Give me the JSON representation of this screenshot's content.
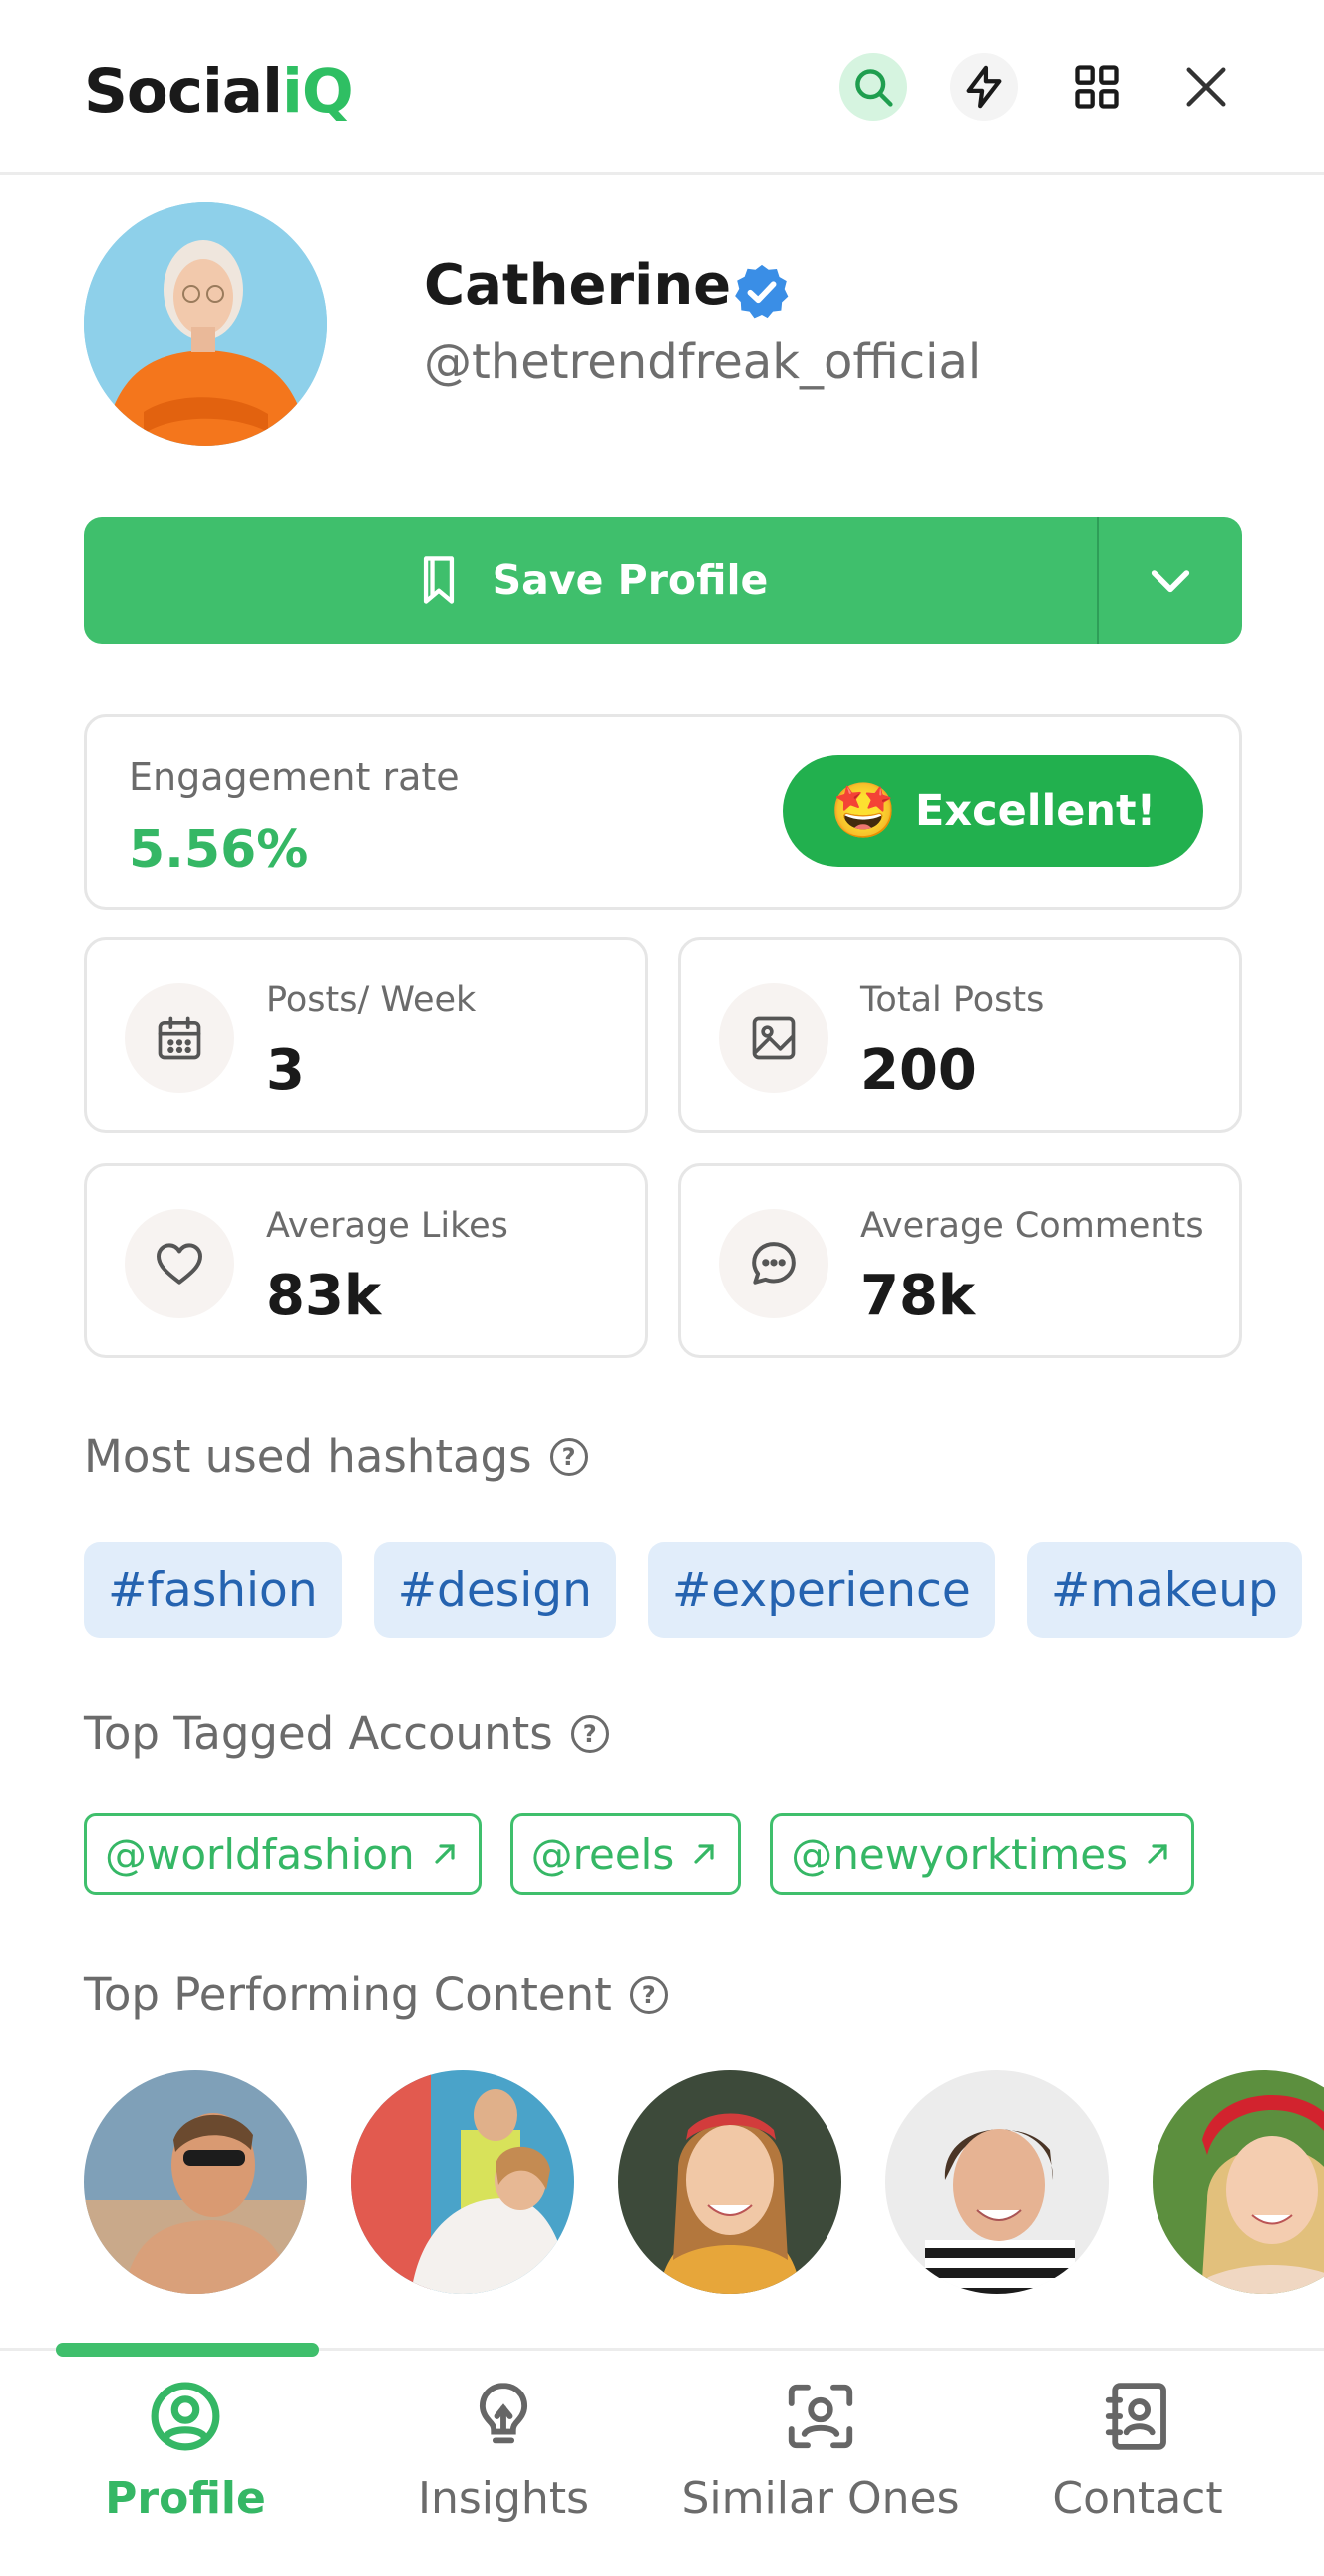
{
  "app": {
    "brand_main": "Social",
    "brand_accent": "iQ"
  },
  "header": {
    "icons": [
      "search-icon",
      "bolt-icon",
      "grid-icon",
      "close-icon"
    ]
  },
  "profile": {
    "name": "Catherine",
    "handle": "@thetrendfreak_official",
    "verified": true
  },
  "save": {
    "label": "Save Profile"
  },
  "engagement": {
    "label": "Engagement rate",
    "value": "5.56%",
    "badge": "Excellent!",
    "badge_emoji": "🤩"
  },
  "stats": [
    {
      "label": "Posts/ Week",
      "value": "3",
      "icon": "calendar-icon"
    },
    {
      "label": "Total Posts",
      "value": "200",
      "icon": "image-icon"
    },
    {
      "label": "Average Likes",
      "value": "83k",
      "icon": "heart-icon"
    },
    {
      "label": "Average Comments",
      "value": "78k",
      "icon": "chat-icon"
    }
  ],
  "hashtags": {
    "title": "Most used hashtags",
    "items": [
      "#fashion",
      "#design",
      "#experience",
      "#makeup"
    ]
  },
  "tagged": {
    "title": "Top Tagged Accounts",
    "items": [
      "@worldfashion",
      "@reels",
      "@newyorktimes"
    ]
  },
  "content": {
    "title": "Top Performing Content"
  },
  "nav": {
    "items": [
      {
        "label": "Profile",
        "icon": "profile-icon",
        "active": true
      },
      {
        "label": "Insights",
        "icon": "lightbulb-icon",
        "active": false
      },
      {
        "label": "Similar Ones",
        "icon": "face-scan-icon",
        "active": false
      },
      {
        "label": "Contact",
        "icon": "contact-book-icon",
        "active": false
      }
    ]
  },
  "colors": {
    "accent": "#3fbf6c",
    "badge": "#22b04e",
    "tag_bg": "#e1edfa",
    "tag_text": "#2563b0"
  }
}
